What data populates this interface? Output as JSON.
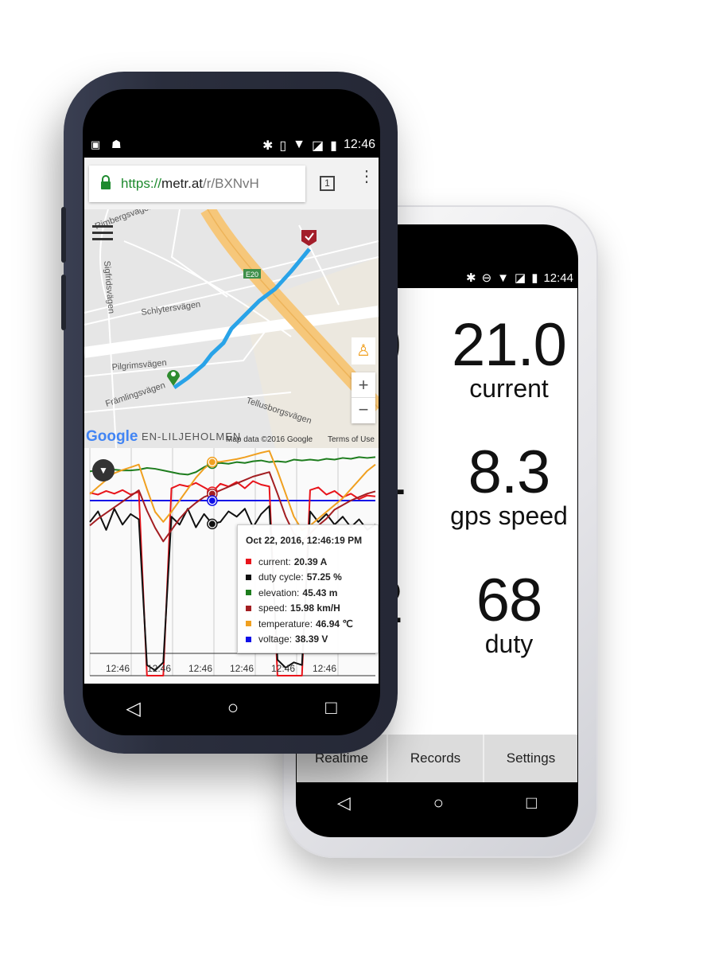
{
  "back_phone": {
    "status_time": "12:44",
    "status_icons": [
      "bluetooth-icon",
      "do-not-disturb-icon",
      "wifi-icon",
      "no-sim-icon",
      "battery-charging-icon"
    ],
    "metrics_left_fragments": [
      {
        "value": "9",
        "label": "e"
      },
      {
        "value": "1",
        "label": ""
      },
      {
        "value": "2",
        "label": ""
      }
    ],
    "metrics": [
      {
        "value": "21.0",
        "label": "current"
      },
      {
        "value": "8.3",
        "label": "gps speed"
      },
      {
        "value": "68",
        "label": "duty"
      }
    ],
    "tabs": [
      {
        "label": "Realtime"
      },
      {
        "label": "Records"
      },
      {
        "label": "Settings"
      }
    ],
    "nav": [
      "back-icon",
      "home-icon",
      "recents-icon"
    ]
  },
  "front_phone": {
    "status_time": "12:46",
    "status_icons_left": [
      "image-icon",
      "android-icon"
    ],
    "status_icons_right": [
      "bluetooth-icon",
      "vibrate-icon",
      "wifi-icon",
      "no-sim-icon",
      "battery-charging-icon"
    ],
    "browser": {
      "url_scheme": "https://",
      "url_host": "metr.at",
      "url_path": "/r/BXNvH",
      "tab_count": "1"
    },
    "map": {
      "streets": [
        "Rimbergsvägen",
        "Sigfridsvägen",
        "Schlytersvägen",
        "Pilgrimsvägen",
        "Främlingsvägen",
        "Tellusborgsvägen",
        "EN-LILJEHOLMEN",
        "vägen"
      ],
      "highway_label": "E20",
      "logo": "Google",
      "attribution": "Map data ©2016 Google",
      "terms": "Terms of Use",
      "zoom_in": "+",
      "zoom_out": "−",
      "colors": {
        "route": "#29a3e8",
        "highway": "#f6c77a",
        "start": "#2e8b2e",
        "end": "#a31e2a"
      }
    },
    "chart_data": {
      "type": "line",
      "x_tick_labels": [
        "12:46",
        "12:46",
        "12:46",
        "12:46",
        "12:46",
        "12:46"
      ],
      "grid": true,
      "tooltip": {
        "title": "Oct 22, 2016, 12:46:19 PM",
        "items": [
          {
            "name": "current",
            "value": "20.39 A"
          },
          {
            "name": "duty cycle",
            "value": "57.25 %"
          },
          {
            "name": "elevation",
            "value": "45.43 m"
          },
          {
            "name": "speed",
            "value": "15.98 km/H"
          },
          {
            "name": "temperature",
            "value": "46.94 ℃"
          },
          {
            "name": "voltage",
            "value": "38.39 V"
          }
        ]
      },
      "highlight_index": 15,
      "series": [
        {
          "name": "current",
          "color": "#e8141b",
          "ylim": [
            0,
            25
          ],
          "values": [
            20.3,
            20.1,
            20.5,
            20.2,
            20.6,
            20.1,
            20.4,
            0,
            0,
            0,
            20.8,
            21.2,
            21.0,
            21.4,
            20.9,
            20.39,
            21.3,
            21.0,
            21.5,
            20.8,
            21.6,
            21.2,
            21.0,
            0,
            0,
            0,
            0,
            20.6,
            20.9,
            20.1,
            20.5,
            19.8,
            20.2,
            19.6,
            20.0,
            19.9
          ]
        },
        {
          "name": "duty cycle",
          "color": "#111111",
          "ylim": [
            0,
            85
          ],
          "values": [
            58,
            62,
            55,
            63,
            57,
            61,
            59,
            4,
            2,
            5,
            60,
            57,
            63,
            56,
            61,
            57.25,
            58,
            62,
            60,
            63,
            56,
            61,
            64,
            6,
            3,
            5,
            4,
            62,
            58,
            61,
            57,
            60,
            56,
            59,
            55,
            57
          ]
        },
        {
          "name": "elevation",
          "color": "#1e7d1e",
          "ylim": [
            20,
            47
          ],
          "values": [
            44.5,
            44.6,
            44.6,
            44.7,
            44.6,
            44.6,
            44.7,
            44.9,
            44.8,
            44.6,
            44.4,
            44.2,
            44.1,
            44.4,
            45.0,
            45.43,
            45.5,
            45.4,
            45.6,
            45.5,
            45.7,
            45.8,
            45.6,
            45.7,
            45.6,
            45.9,
            45.8,
            45.9,
            45.8,
            46.0,
            45.9,
            46.1,
            46.0,
            46.2,
            46.1,
            46.2
          ]
        },
        {
          "name": "speed",
          "color": "#a31e22",
          "ylim": [
            0,
            19.8
          ],
          "values": [
            13.2,
            13.8,
            14.3,
            14.8,
            15.3,
            15.8,
            16.3,
            14.5,
            13,
            11.8,
            12.8,
            13.8,
            14.6,
            15.2,
            15.7,
            15.98,
            16.3,
            16.6,
            16.9,
            17.2,
            17.5,
            17.7,
            17.9,
            16,
            14,
            12.5,
            11.8,
            12.5,
            13.2,
            13.8,
            14.6,
            15,
            15.4,
            15.7,
            16,
            16.2
          ]
        },
        {
          "name": "temperature",
          "color": "#f0a020",
          "ylim": [
            0,
            49.5
          ],
          "values": [
            39.9,
            41.5,
            43,
            44.5,
            45.2,
            45.8,
            46.4,
            41,
            36,
            33.8,
            36,
            38.5,
            41,
            43.5,
            45.5,
            46.94,
            47,
            47.3,
            47.6,
            48,
            48.5,
            49,
            49.4,
            45,
            40,
            35,
            32,
            33,
            34.5,
            36,
            37.5,
            39,
            41,
            43,
            45,
            46.4
          ]
        },
        {
          "name": "voltage",
          "color": "#1010e8",
          "ylim": [
            0,
            49.4
          ],
          "values": [
            38.4,
            38.4,
            38.4,
            38.4,
            38.4,
            38.4,
            38.4,
            38.4,
            38.4,
            38.4,
            38.4,
            38.4,
            38.4,
            38.4,
            38.4,
            38.39,
            38.4,
            38.4,
            38.4,
            38.4,
            38.4,
            38.4,
            38.4,
            38.4,
            38.4,
            38.4,
            38.4,
            38.4,
            38.4,
            38.4,
            38.4,
            38.4,
            38.4,
            38.4,
            38.4,
            38.4
          ]
        }
      ]
    },
    "nav": [
      "back-icon",
      "home-icon",
      "recents-icon"
    ]
  }
}
